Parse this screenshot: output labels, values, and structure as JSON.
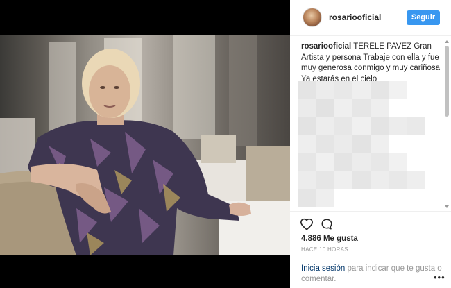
{
  "header": {
    "username": "rosariooficial",
    "follow_label": "Seguir"
  },
  "caption": {
    "username": "rosariooficial",
    "text": "TERELE PAVEZ Gran Artista y persona Trabaje con ella y fue muy generosa conmigo y muy cariñosa Ya estarás en el cielo"
  },
  "post": {
    "likes": "4.886 Me gusta",
    "time": "HACE 10 HORAS"
  },
  "login": {
    "link": "Inicia sesión",
    "rest": "para indicar que te gusta o comentar."
  },
  "icons": {
    "like": "heart-icon",
    "comment": "comment-icon",
    "more": "more-icon"
  },
  "colors": {
    "accent": "#3897f0",
    "text": "#262626",
    "muted": "#999999",
    "link": "#003569"
  }
}
